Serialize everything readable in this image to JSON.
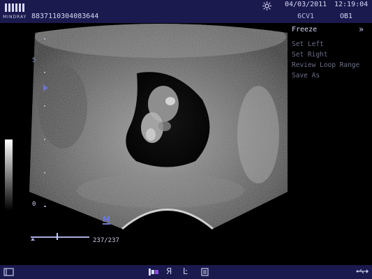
{
  "header": {
    "brand": "MINDRAY",
    "patient_id": "8837110304083644",
    "date": "04/03/2011",
    "time": "12:19:04",
    "probe": "6CV1",
    "exam_mode": "OB1"
  },
  "image": {
    "depth_zero_label": "0",
    "top_label": "5",
    "marker_letter": "M"
  },
  "cine": {
    "frame_counter": "237/237",
    "position": 0.45
  },
  "menu": {
    "title": "Freeze",
    "items": [
      {
        "label": "Set Left"
      },
      {
        "label": "Set Right"
      },
      {
        "label": "Review Loop Range"
      },
      {
        "label": "Save As"
      }
    ]
  },
  "colors": {
    "bar_background": "#1a1a4e",
    "text": "#d7d9f5",
    "menu_disabled": "#6c6f8a",
    "marker": "#6a78e0"
  },
  "icons": {
    "top": [
      "mindray-logo",
      "freeze-sun-icon"
    ],
    "bottom": [
      "screen-icon",
      "probe-icon",
      "r-icon",
      "k-icon",
      "document-icon",
      "usb-icon"
    ]
  }
}
